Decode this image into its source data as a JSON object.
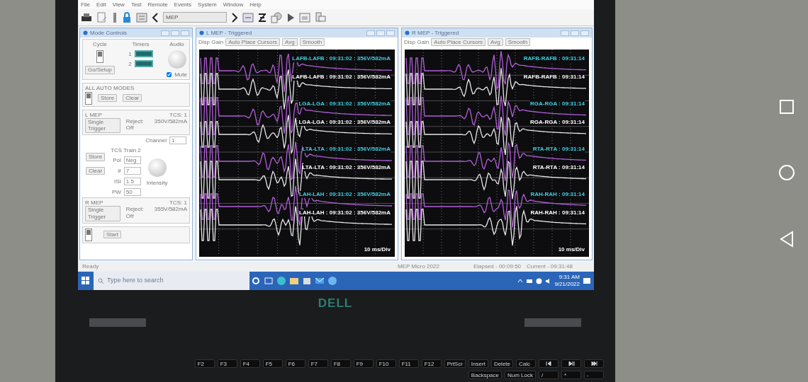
{
  "menu": [
    "File",
    "Edit",
    "View",
    "Test",
    "Remote",
    "Events",
    "System",
    "Window",
    "Help"
  ],
  "toolbar": {
    "mode_select": "MEP"
  },
  "mode_controls": {
    "title": "Mode Controls",
    "cycle_label": "Cycle",
    "cycle_switch": {
      "on": true
    },
    "start_switch": {
      "on": true
    },
    "timers_label": "Timers",
    "audio_label": "Audio",
    "timer_rows": [
      "1",
      "2"
    ],
    "setup_button": "Go/Setup",
    "mute": {
      "label": "Mute",
      "checked": true
    },
    "auto_modes": {
      "title": "ALL AUTO MODES",
      "switch": {
        "on": true
      },
      "buttons": [
        "Store",
        "Clear"
      ]
    },
    "l_mep": {
      "title": "L MEP",
      "trigger": "Single Trigger",
      "reject": "Reject: Off",
      "tcs": "TCS: 1",
      "reading": "350V/582mA"
    },
    "channel_label": "Channel",
    "channel_value": "1",
    "train_label": "TCS Train 2",
    "side_buttons": [
      "Store",
      "Clear"
    ],
    "params": [
      {
        "label": "Pol",
        "value": "Neg"
      },
      {
        "label": "#",
        "value": "7"
      },
      {
        "label": "ISI",
        "value": "1.5"
      },
      {
        "label": "PW",
        "value": "50"
      }
    ],
    "intensity_label": "Intensity",
    "r_mep": {
      "title": "R MEP",
      "trigger": "Single Trigger",
      "reject": "Reject: Off",
      "tcs": "TCS: 1",
      "reading": "355V/582mA"
    },
    "start_button": "Start"
  },
  "panels": [
    {
      "title": "L MEP - Triggered",
      "controls": [
        "Disp Gain",
        "Auto Place Cursors",
        "Avg",
        "Smooth"
      ],
      "scale": "10 ms/Div",
      "traces": [
        {
          "label": "LAFB-LAFB : 09:31:02 : 356V/582mA",
          "color": "#3fd0e0"
        },
        {
          "label": "LAFB-LAFB : 09:31:02 : 356V/582mA",
          "color": "#ffffff"
        },
        {
          "label": "LGA-LGA : 09:31:02 : 356V/582mA",
          "color": "#3fd0e0"
        },
        {
          "label": "LGA-LGA : 09:31:02 : 356V/582mA",
          "color": "#ffffff"
        },
        {
          "label": "LTA-LTA : 09:31:02 : 356V/582mA",
          "color": "#3fd0e0"
        },
        {
          "label": "LTA-LTA : 09:31:02 : 356V/582mA",
          "color": "#ffffff"
        },
        {
          "label": "LAH-LAH : 09:31:02 : 356V/582mA",
          "color": "#3fd0e0"
        },
        {
          "label": "LAH-LAH : 09:31:02 : 356V/582mA",
          "color": "#ffffff"
        }
      ]
    },
    {
      "title": "R MEP - Triggered",
      "controls": [
        "Disp Gain",
        "Auto Place Cursors",
        "Avg",
        "Smooth"
      ],
      "scale": "10 ms/Div",
      "traces": [
        {
          "label": "RAFB-RAFB : 09:31:14",
          "color": "#3fd0e0"
        },
        {
          "label": "RAFB-RAFB : 09:31:14",
          "color": "#ffffff"
        },
        {
          "label": "RGA-RGA : 09:31:14",
          "color": "#3fd0e0"
        },
        {
          "label": "RGA-RGA : 09:31:14",
          "color": "#ffffff"
        },
        {
          "label": "RTA-RTA : 09:31:14",
          "color": "#3fd0e0"
        },
        {
          "label": "RTA-RTA : 09:31:14",
          "color": "#ffffff"
        },
        {
          "label": "RAH-RAH : 09:31:14",
          "color": "#3fd0e0"
        },
        {
          "label": "RAH-RAH : 09:31:14",
          "color": "#ffffff"
        }
      ]
    }
  ],
  "status_bar": {
    "left": "Ready",
    "center": "MEP Micro 2022",
    "elapsed": "Elapsed - 00:09:50",
    "current": "Current - 09:31:48"
  },
  "taskbar": {
    "search_placeholder": "Type here to search",
    "time": "9:31 AM",
    "date": "9/21/2022"
  },
  "laptop": {
    "logo": "DELL"
  },
  "keyboard": {
    "top_row": [
      "F2",
      "F3",
      "F4",
      "F5",
      "F6",
      "F7",
      "F8",
      "F9",
      "F10",
      "F11",
      "F12",
      "PrtScr",
      "Insert",
      "Delete",
      "Calc"
    ],
    "bottom_row": [
      "Backspace",
      "Num Lock",
      "/",
      "*",
      "-"
    ]
  }
}
